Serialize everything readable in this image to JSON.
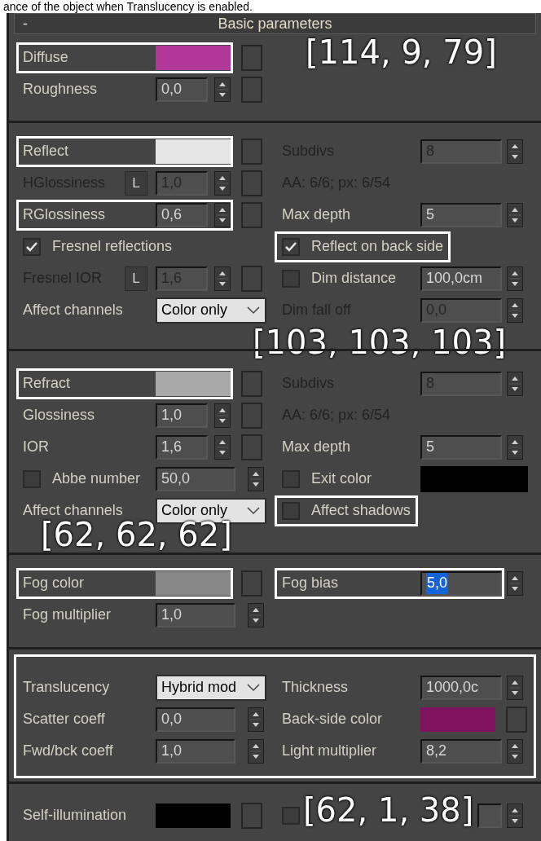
{
  "caption_fragment": "ance of the object when Translucency is enabled.",
  "panel": {
    "collapse_symbol": "-",
    "title": "Basic parameters"
  },
  "sections": [
    {
      "highlighted": false,
      "annotation": "[114, 9, 79]",
      "left": [
        {
          "kind": "color",
          "label": "Diffuse",
          "color": "#b0389a",
          "map_button": true,
          "highlighted": true
        },
        {
          "kind": "spinner",
          "label": "Roughness",
          "value": "0,0",
          "map_button": true
        }
      ]
    },
    {
      "highlighted": false,
      "annotation": "[103, 103, 103]",
      "left": [
        {
          "kind": "color",
          "label": "Reflect",
          "color": "#e6e6e6",
          "map_button": true,
          "highlighted": true
        },
        {
          "kind": "spinner",
          "label": "HGlossiness",
          "lock": "L",
          "value": "1,0",
          "map_button": true,
          "disabled": true
        },
        {
          "kind": "spinner",
          "label": "RGlossiness",
          "value": "0,6",
          "map_button": true,
          "highlighted": true
        },
        {
          "kind": "checkbox",
          "label": "Fresnel reflections",
          "checked": true
        },
        {
          "kind": "spinner",
          "label": "Fresnel IOR",
          "lock": "L",
          "value": "1,6",
          "map_button": true,
          "disabled": true
        },
        {
          "kind": "dropdown",
          "label": "Affect channels",
          "value": "Color only"
        }
      ],
      "right": [
        {
          "kind": "spinner",
          "label": "Subdivs",
          "value": "8",
          "disabled": true
        },
        {
          "kind": "text",
          "label": "AA: 6/6; px: 6/54",
          "disabled": true
        },
        {
          "kind": "spinner",
          "label": "Max depth",
          "value": "5"
        },
        {
          "kind": "checkbox",
          "label": "Reflect on back side",
          "checked": true,
          "highlighted": true
        },
        {
          "kind": "checkbox_spinner",
          "label": "Dim distance",
          "checked": false,
          "value": "100,0cm"
        },
        {
          "kind": "spinner",
          "label": "Dim fall off",
          "value": "0,0",
          "disabled": true
        }
      ]
    },
    {
      "highlighted": false,
      "annotation": "[62, 62, 62]",
      "left": [
        {
          "kind": "color",
          "label": "Refract",
          "color": "#a8a8a8",
          "map_button": true,
          "highlighted": true
        },
        {
          "kind": "spinner",
          "label": "Glossiness",
          "value": "1,0",
          "map_button": true
        },
        {
          "kind": "spinner",
          "label": "IOR",
          "value": "1,6",
          "map_button": true
        },
        {
          "kind": "checkbox_spinner",
          "label": "Abbe number",
          "checked": false,
          "value": "50,0"
        },
        {
          "kind": "dropdown",
          "label": "Affect channels",
          "value": "Color only"
        }
      ],
      "right": [
        {
          "kind": "spinner",
          "label": "Subdivs",
          "value": "8",
          "disabled": true
        },
        {
          "kind": "text",
          "label": "AA: 6/6; px: 6/54",
          "disabled": true
        },
        {
          "kind": "spinner",
          "label": "Max depth",
          "value": "5"
        },
        {
          "kind": "checkbox_color",
          "label": "Exit color",
          "checked": false,
          "color": "#000000"
        },
        {
          "kind": "checkbox",
          "label": "Affect shadows",
          "checked": false,
          "highlighted": true
        }
      ]
    },
    {
      "highlighted": false,
      "left": [
        {
          "kind": "color",
          "label": "Fog color",
          "color": "#878787",
          "map_button": true,
          "highlighted": true
        },
        {
          "kind": "spinner",
          "label": "Fog multiplier",
          "value": "1,0",
          "map_button": false
        }
      ],
      "right": [
        {
          "kind": "spinner",
          "label": "Fog bias",
          "value": "5,0",
          "value_selected": true,
          "highlighted": true
        }
      ]
    },
    {
      "highlighted": true,
      "left": [
        {
          "kind": "dropdown",
          "label": "Translucency",
          "value": "Hybrid mod"
        },
        {
          "kind": "spinner",
          "label": "Scatter coeff",
          "value": "0,0",
          "map_button": false
        },
        {
          "kind": "spinner",
          "label": "Fwd/bck coeff",
          "value": "1,0",
          "map_button": false
        }
      ],
      "right": [
        {
          "kind": "spinner",
          "label": "Thickness",
          "value": "1000,0c"
        },
        {
          "kind": "color",
          "label": "Back-side color",
          "color": "#7f135e",
          "map_button": true
        },
        {
          "kind": "spinner",
          "label": "Light multiplier",
          "value": "8,2"
        }
      ]
    },
    {
      "highlighted": false,
      "annotation": "[62, 1, 38]",
      "left": [
        {
          "kind": "color",
          "label": "Self-illumination",
          "color": "#000000",
          "map_button": true
        }
      ],
      "right": [
        {
          "kind": "checkbox_spinner",
          "checked": false
        }
      ]
    }
  ]
}
